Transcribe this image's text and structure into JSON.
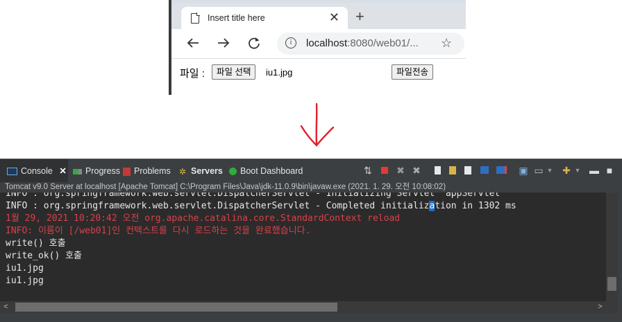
{
  "browser": {
    "tab_title": "Insert title here",
    "url_host": "localhost",
    "url_rest": ":8080/web01/...",
    "form_label": "파일 :",
    "choose_button": "파일 선택",
    "chosen_file": "iu1.jpg",
    "submit_button": "파일전송"
  },
  "console": {
    "tabs": [
      {
        "label": "Console"
      },
      {
        "label": "Progress"
      },
      {
        "label": "Problems"
      },
      {
        "label": "Servers"
      },
      {
        "label": "Boot Dashboard"
      }
    ],
    "status": "Tomcat v9.0 Server at localhost [Apache Tomcat] C:\\Program Files\\Java\\jdk-11.0.9\\bin\\javaw.exe  (2021. 1. 29. 오전 10:08:02)",
    "lines": [
      {
        "text": "INFO : org.springframework.web.servlet.DispatcherServlet - Initializing Servlet 'appServlet'",
        "color": "#e8e8e8"
      },
      {
        "pre": "INFO : org.springframework.web.servlet.DispatcherServlet - Completed initializ",
        "hl": "a",
        "post": "tion in 1302 ms",
        "color": "#e8e8e8"
      },
      {
        "text": "1월 29, 2021 10:20:42 오전 org.apache.catalina.core.StandardContext reload",
        "color": "#d9404a"
      },
      {
        "text": "INFO: 이름이 [/web01]인 컨텍스트를 다시 로드하는 것을 완료했습니다.",
        "color": "#d9404a"
      },
      {
        "text": "write() 호출",
        "color": "#e8e8e8"
      },
      {
        "text": "write_ok() 호출",
        "color": "#e8e8e8"
      },
      {
        "text": "iu1.jpg",
        "color": "#e8e8e8"
      },
      {
        "text": "iu1.jpg",
        "color": "#e8e8e8"
      }
    ]
  },
  "colors": {
    "console_bg": "#2b2b2b",
    "stderr_red": "#d9404a",
    "arrow_red": "#e0202a",
    "terminate_red": "#e53935"
  }
}
